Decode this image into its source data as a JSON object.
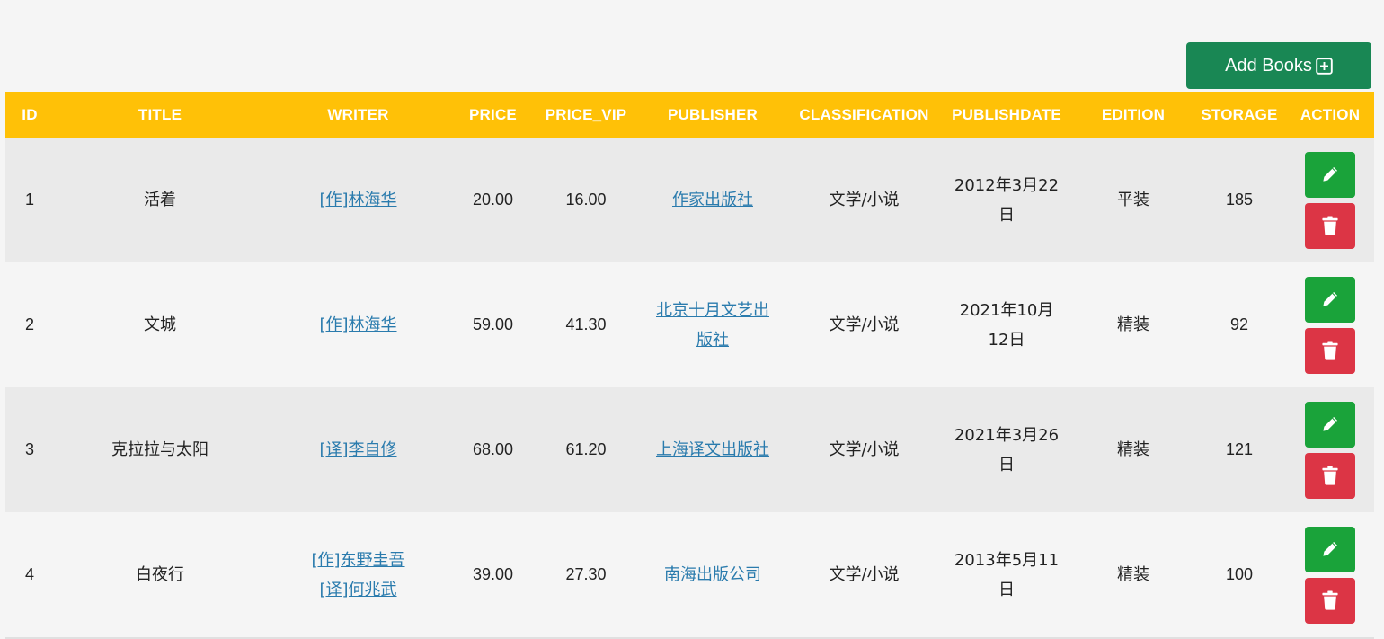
{
  "toolbar": {
    "add_label": "Add Books"
  },
  "colors": {
    "header_bg": "#ffc107",
    "add_button": "#198754",
    "edit_button": "#1aa33a",
    "delete_button": "#dc3545",
    "link": "#2a7bad"
  },
  "table": {
    "headers": [
      "ID",
      "TITLE",
      "WRITER",
      "PRICE",
      "PRICE_VIP",
      "PUBLISHER",
      "CLASSIFICATION",
      "PUBLISHDATE",
      "EDITION",
      "STORAGE",
      "ACTION"
    ],
    "rows": [
      {
        "id": "1",
        "title": "活着",
        "writers": [
          "[作]林海华"
        ],
        "price": "20.00",
        "price_vip": "16.00",
        "publisher": "作家出版社",
        "classification": "文学/小说",
        "publishdate": "2012年3月22日",
        "edition": "平装",
        "storage": "185"
      },
      {
        "id": "2",
        "title": "文城",
        "writers": [
          "[作]林海华"
        ],
        "price": "59.00",
        "price_vip": "41.30",
        "publisher": "北京十月文艺出版社",
        "classification": "文学/小说",
        "publishdate": "2021年10月12日",
        "edition": "精装",
        "storage": "92"
      },
      {
        "id": "3",
        "title": "克拉拉与太阳",
        "writers": [
          "[译]李自修"
        ],
        "price": "68.00",
        "price_vip": "61.20",
        "publisher": "上海译文出版社",
        "classification": "文学/小说",
        "publishdate": "2021年3月26日",
        "edition": "精装",
        "storage": "121"
      },
      {
        "id": "4",
        "title": "白夜行",
        "writers": [
          "[作]东野圭吾",
          "[译]何兆武"
        ],
        "price": "39.00",
        "price_vip": "27.30",
        "publisher": "南海出版公司",
        "classification": "文学/小说",
        "publishdate": "2013年5月11日",
        "edition": "精装",
        "storage": "100"
      }
    ],
    "action_icons": {
      "edit": "pencil-icon",
      "delete": "trash-icon"
    }
  }
}
